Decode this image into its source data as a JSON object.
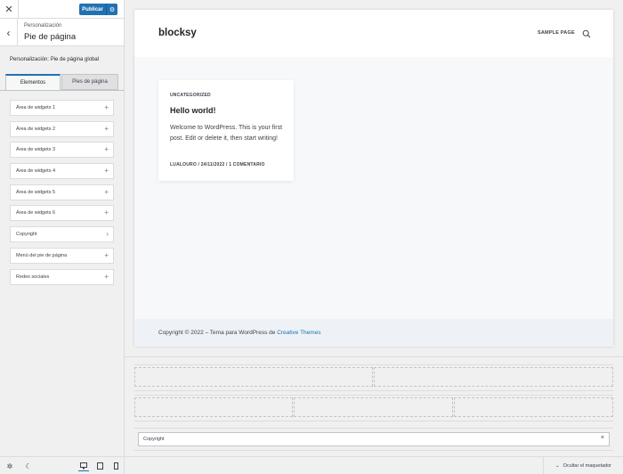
{
  "topbar": {
    "close_icon": "close-icon",
    "publish_label": "Publicar",
    "publish_settings_icon": "gear-icon"
  },
  "section": {
    "breadcrumb": "Personalización",
    "title": "Pie de página",
    "subtitle": "Personalización: Pie de página global"
  },
  "tabs": [
    {
      "label": "Elementos",
      "active": true
    },
    {
      "label": "Pies de página",
      "active": false
    }
  ],
  "items": [
    {
      "label": "Área de widgets 1",
      "icon": "plus-icon",
      "glyph": "+"
    },
    {
      "label": "Área de widgets 2",
      "icon": "plus-icon",
      "glyph": "+"
    },
    {
      "label": "Área de widgets 3",
      "icon": "plus-icon",
      "glyph": "+"
    },
    {
      "label": "Área de widgets 4",
      "icon": "plus-icon",
      "glyph": "+"
    },
    {
      "label": "Área de widgets 5",
      "icon": "plus-icon",
      "glyph": "+"
    },
    {
      "label": "Área de widgets 6",
      "icon": "plus-icon",
      "glyph": "+"
    },
    {
      "label": "Copyright",
      "icon": "chevron-right-icon",
      "glyph": "›"
    },
    {
      "label": "Menú del pie de página",
      "icon": "plus-icon",
      "glyph": "+"
    },
    {
      "label": "Redes sociales",
      "icon": "plus-icon",
      "glyph": "+"
    }
  ],
  "bottombar": {
    "icons": [
      "settings-icon",
      "dark-mode-icon",
      "desktop-icon",
      "tablet-icon",
      "mobile-icon"
    ]
  },
  "site": {
    "logo": "blocksy",
    "nav_link": "SAMPLE PAGE",
    "post": {
      "category": "UNCATEGORIZED",
      "title": "Hello world!",
      "excerpt": "Welcome to WordPress. This is your first post. Edit or delete it, then start writing!",
      "meta": "LUALOURO / 24/11/2022 / 1 COMENTARIO"
    },
    "footer": {
      "text": "Copyright © 2022 – Tema para WordPress de ",
      "link": "Creative Themes"
    }
  },
  "builder": {
    "copyright_chip": "Copyright",
    "chip_close": "×",
    "hide_label": "Ocultar el maquetador"
  },
  "colors": {
    "accent": "#2271b1",
    "panel_bg": "#f0f0f1",
    "footer_bg": "#eef2f6"
  }
}
